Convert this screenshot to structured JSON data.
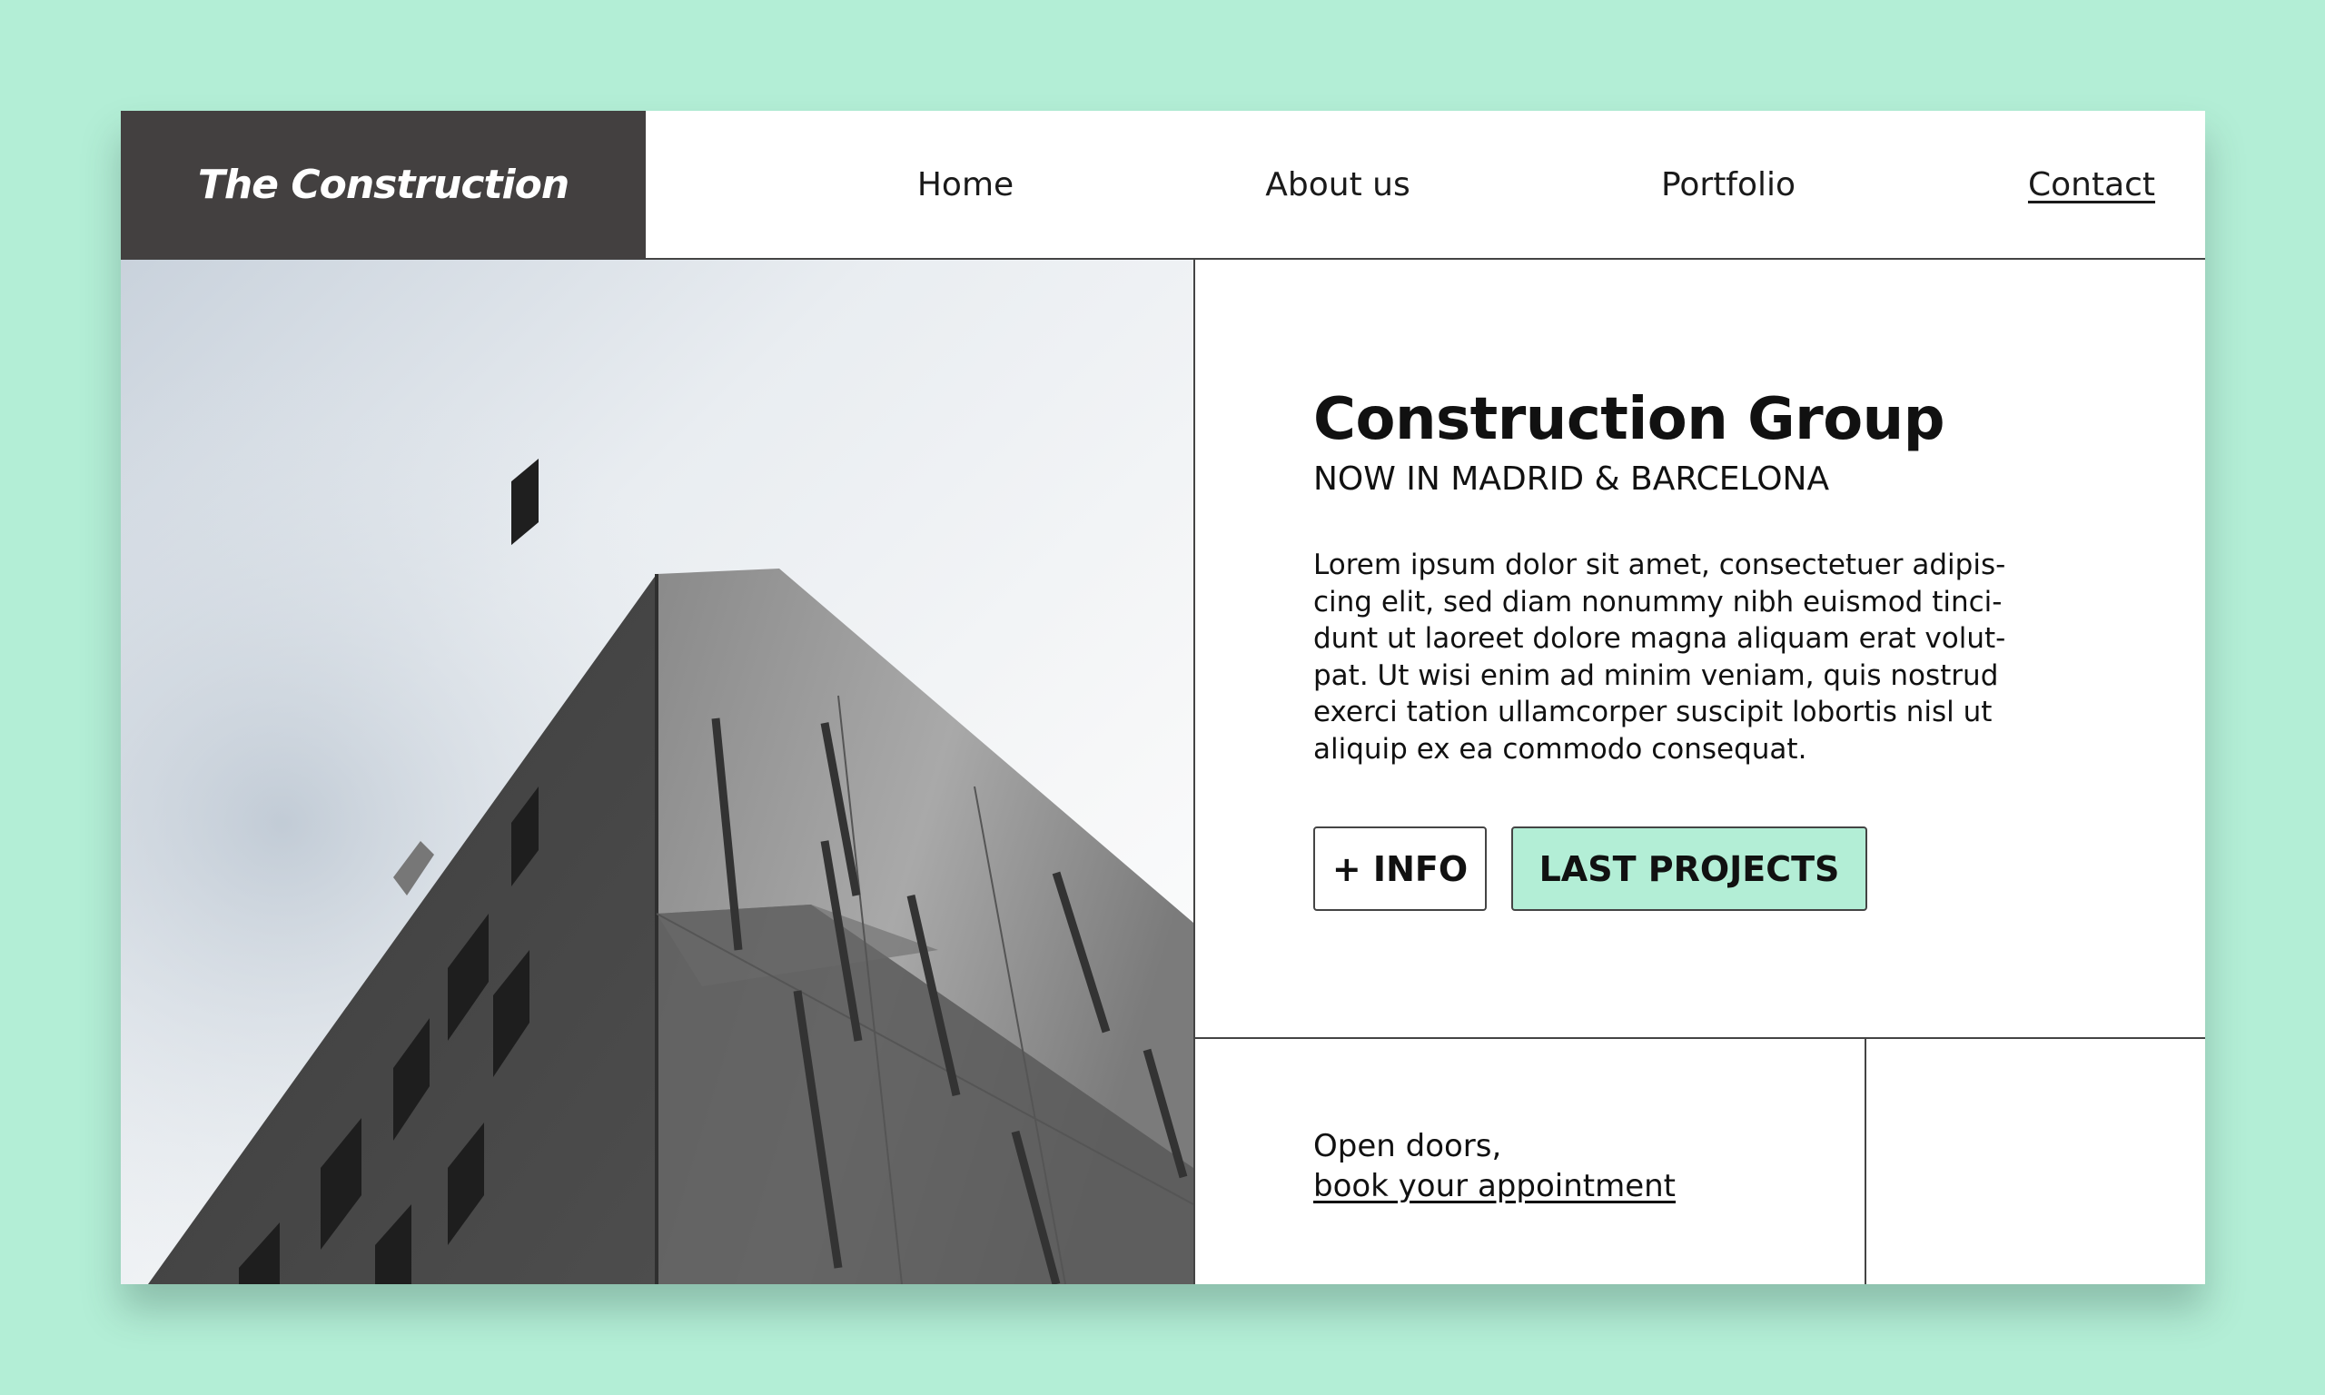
{
  "header": {
    "brand": "The Construction",
    "nav": {
      "home": "Home",
      "about": "About us",
      "portfolio": "Portfolio",
      "contact": "Contact"
    }
  },
  "hero": {
    "title": "Construction Group",
    "subtitle": "NOW IN MADRID & BARCELONA",
    "body": "Lorem ipsum dolor sit amet, consectetuer adipis-cing elit, sed diam nonummy nibh euismod tinci-dunt ut laoreet dolore magna aliquam erat volut-pat. Ut wisi enim ad minim veniam, quis nostrud exerci tation ullamcorper suscipit lobortis nisl ut aliquip ex ea commodo consequat.",
    "info_button": "+ INFO",
    "projects_button": "LAST PROJECTS"
  },
  "footer": {
    "open_doors": "Open doors,",
    "book_link": "book your appointment"
  },
  "colors": {
    "background": "#b3eed6",
    "brand_block": "#434040",
    "accent_button": "#b3eed6"
  }
}
